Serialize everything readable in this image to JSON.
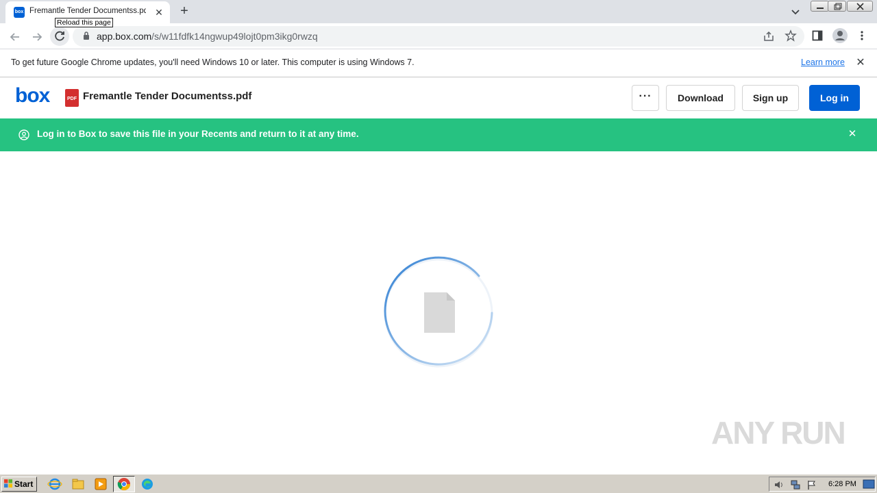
{
  "browser": {
    "tab": {
      "title": "Fremantle Tender Documentss.pdf | Powered by Box",
      "favicon_label": "box"
    },
    "new_tab_label": "+",
    "tooltip": "Reload this page",
    "url": {
      "host": "app.box.com",
      "path": "/s/w11fdfk14ngwup49lojt0pm3ikg0rwzq"
    }
  },
  "infobar": {
    "message": "To get future Google Chrome updates, you'll need Windows 10 or later. This computer is using Windows 7.",
    "learn_more": "Learn more",
    "close": "✕"
  },
  "box": {
    "logo": "box",
    "file_type": "PDF",
    "file_name": "Fremantle Tender Documentss.pdf",
    "more_label": "···",
    "download_label": "Download",
    "signup_label": "Sign up",
    "login_label": "Log in"
  },
  "banner": {
    "message": "Log in to Box to save this file in your Recents and return to it at any time.",
    "close": "✕"
  },
  "watermark": "ANY RUN",
  "taskbar": {
    "start_label": "Start",
    "clock": "6:28 PM"
  },
  "colors": {
    "box_blue": "#0061d5",
    "banner_green": "#26c281",
    "pdf_red": "#d32f2f"
  }
}
